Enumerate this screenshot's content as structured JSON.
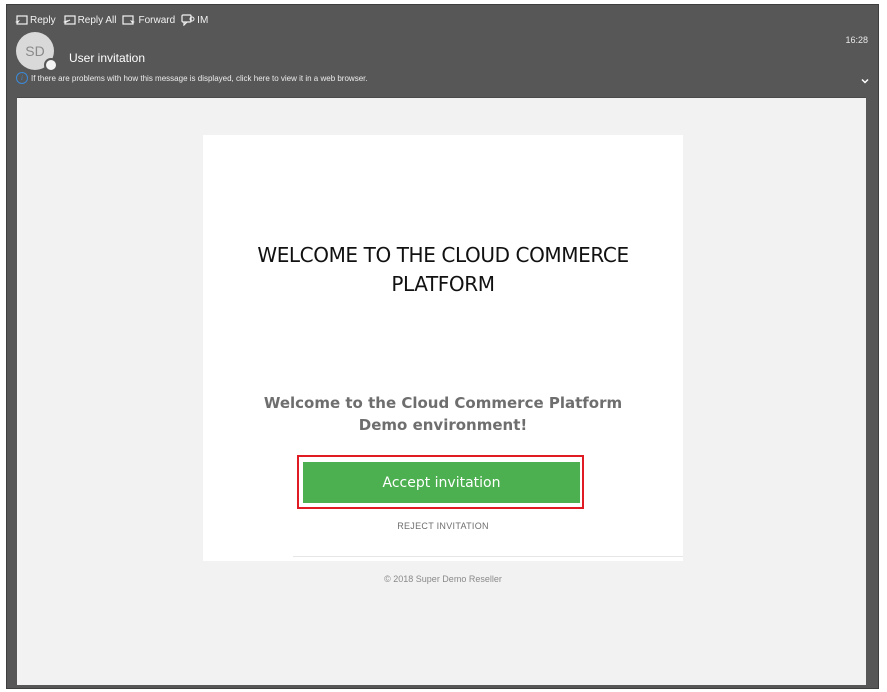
{
  "toolbar": {
    "reply_label": "Reply",
    "reply_all_label": "Reply All",
    "forward_label": "Forward",
    "im_label": "IM"
  },
  "header": {
    "time": "16:28",
    "avatar_initials": "SD",
    "subject": "User invitation",
    "info_text": "If there are problems with how this message is displayed, click here to view it in a web browser.",
    "info_icon_glyph": "i"
  },
  "email": {
    "headline": "WELCOME TO THE CLOUD COMMERCE PLATFORM",
    "welcome_text": "Welcome to the Cloud Commerce Platform Demo environment!",
    "accept_label": "Accept invitation",
    "reject_label": "REJECT INVITATION",
    "footer": "© 2018 Super Demo Reseller"
  },
  "colors": {
    "accept_button": "#4caf50",
    "highlight_border": "#e01b24",
    "header_bg": "#575757"
  }
}
